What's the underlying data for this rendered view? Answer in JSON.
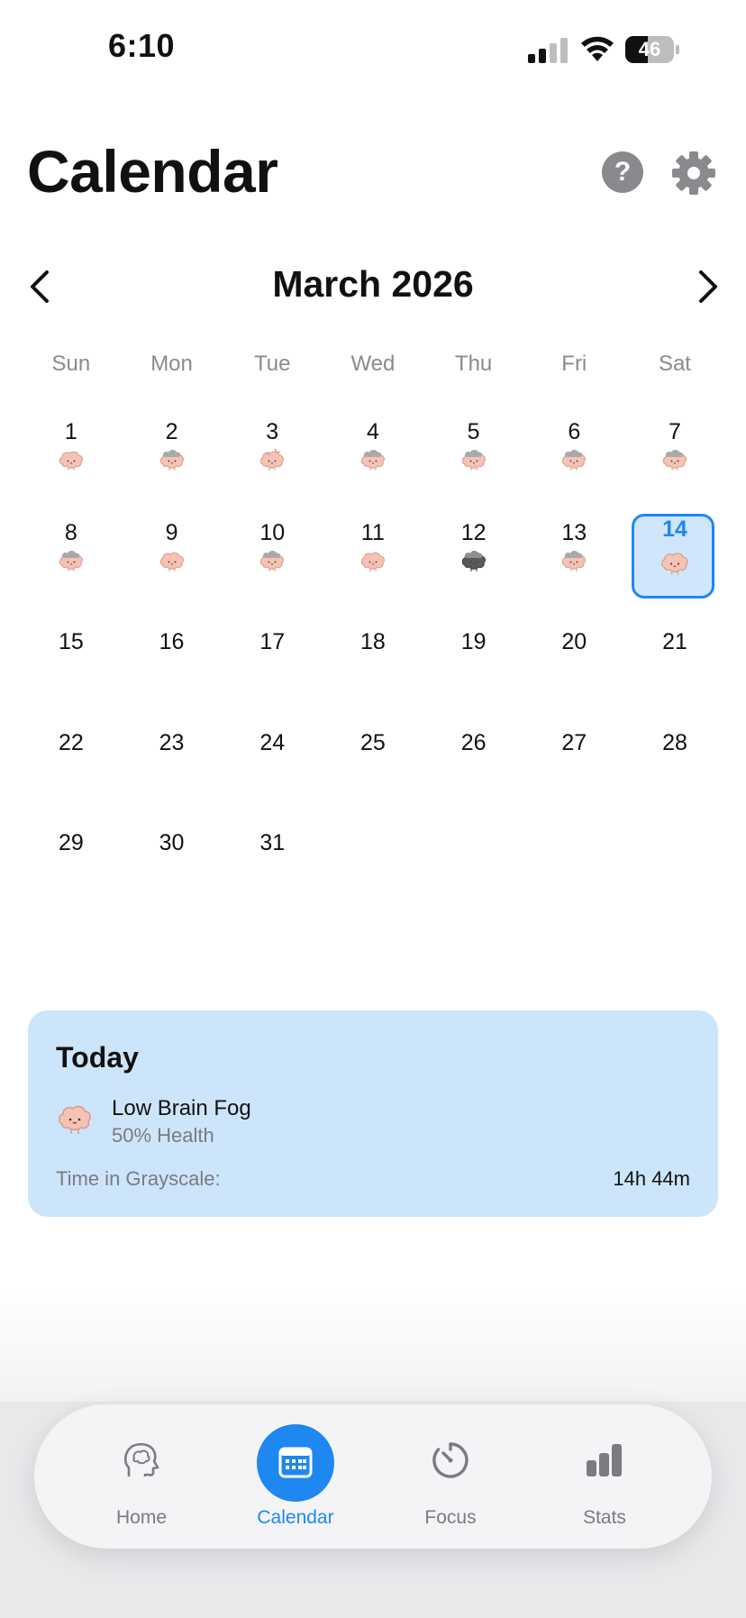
{
  "status_bar": {
    "time": "6:10",
    "battery": "46",
    "battery_level": 0.46
  },
  "header": {
    "title": "Calendar",
    "help_label": "?",
    "settings_icon": "gear-icon"
  },
  "month_nav": {
    "title": "March 2026",
    "prev_icon": "chevron-left-icon",
    "next_icon": "chevron-right-icon"
  },
  "weekdays": [
    "Sun",
    "Mon",
    "Tue",
    "Wed",
    "Thu",
    "Fri",
    "Sat"
  ],
  "days": [
    {
      "n": "1",
      "icon": "brain-clear"
    },
    {
      "n": "2",
      "icon": "brain-cloud"
    },
    {
      "n": "3",
      "icon": "brain-hurt"
    },
    {
      "n": "4",
      "icon": "brain-cloud"
    },
    {
      "n": "5",
      "icon": "brain-cloud"
    },
    {
      "n": "6",
      "icon": "brain-cloud"
    },
    {
      "n": "7",
      "icon": "brain-cloud"
    },
    {
      "n": "8",
      "icon": "brain-cloud"
    },
    {
      "n": "9",
      "icon": "brain-clear"
    },
    {
      "n": "10",
      "icon": "brain-cloud"
    },
    {
      "n": "11",
      "icon": "brain-clear"
    },
    {
      "n": "12",
      "icon": "brain-dark"
    },
    {
      "n": "13",
      "icon": "brain-cloud"
    },
    {
      "n": "14",
      "icon": "brain-clear",
      "today": true
    },
    {
      "n": "15"
    },
    {
      "n": "16"
    },
    {
      "n": "17"
    },
    {
      "n": "18"
    },
    {
      "n": "19"
    },
    {
      "n": "20"
    },
    {
      "n": "21"
    },
    {
      "n": "22"
    },
    {
      "n": "23"
    },
    {
      "n": "24"
    },
    {
      "n": "25"
    },
    {
      "n": "26"
    },
    {
      "n": "27"
    },
    {
      "n": "28"
    },
    {
      "n": "29"
    },
    {
      "n": "30"
    },
    {
      "n": "31"
    }
  ],
  "today_card": {
    "title": "Today",
    "status": "Low Brain Fog",
    "health": "50% Health",
    "time_label": "Time in Grayscale:",
    "time_value": "14h 44m",
    "icon": "brain-clear"
  },
  "tabbar": {
    "tabs": [
      {
        "label": "Home",
        "icon": "brain-head-icon",
        "active": false
      },
      {
        "label": "Calendar",
        "icon": "calendar-icon",
        "active": true
      },
      {
        "label": "Focus",
        "icon": "timer-icon",
        "active": false
      },
      {
        "label": "Stats",
        "icon": "bar-chart-icon",
        "active": false
      }
    ]
  },
  "colors": {
    "accent": "#1e88f0",
    "card_bg": "#cde5fb",
    "secondary_text": "#8a8a8e",
    "brain_pink": "#f6c2b4"
  }
}
